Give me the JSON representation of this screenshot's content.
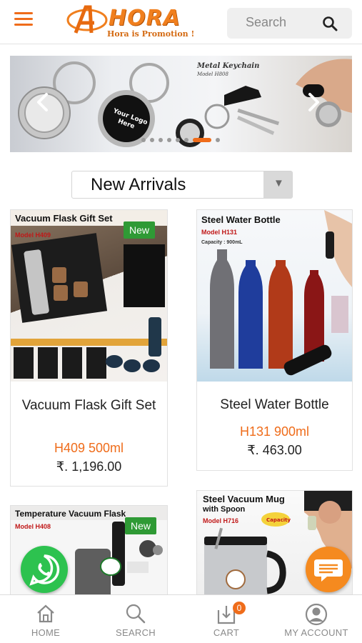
{
  "header": {
    "logo_text": "HORA",
    "logo_tagline": "Hora is Promotion !",
    "search_placeholder": "Search"
  },
  "carousel": {
    "caption": "Metal Keychain",
    "caption_model": "Model H808",
    "keychain_text": "Your Logo Here",
    "slide_count": 8,
    "active_slide": 7
  },
  "section": {
    "selected": "New Arrivals"
  },
  "products": [
    {
      "name": "Vacuum Flask Gift Set",
      "code": "H409 500ml",
      "price": "₹. 1,196.00",
      "badge": "New",
      "image_title": "Vacuum Flask Gift Set",
      "image_model": "Model H409"
    },
    {
      "name": "Steel Water Bottle",
      "code": "H131 900ml",
      "price": "₹. 463.00",
      "image_title": "Steel Water Bottle",
      "image_model": "Model H131",
      "image_capacity": "Capacity : 900mL"
    },
    {
      "badge": "New",
      "image_title": "Temperature Vacuum Flask",
      "image_model": "Model H408"
    },
    {
      "image_title": "Steel Vacuum Mug",
      "image_subtitle": "with Spoon",
      "image_model": "Model H716"
    }
  ],
  "bottom_nav": {
    "home": "HOME",
    "search": "SEARCH",
    "cart": "CART",
    "cart_count": "0",
    "account": "MY ACCOUNT"
  },
  "colors": {
    "accent": "#ef6c1a",
    "new_badge": "#2f9a35",
    "whatsapp": "#2dc24f"
  },
  "icons": [
    "menu-icon",
    "search-icon",
    "chevron-left-icon",
    "chevron-right-icon",
    "whatsapp-icon",
    "chat-icon",
    "home-icon",
    "cart-icon",
    "user-icon"
  ]
}
